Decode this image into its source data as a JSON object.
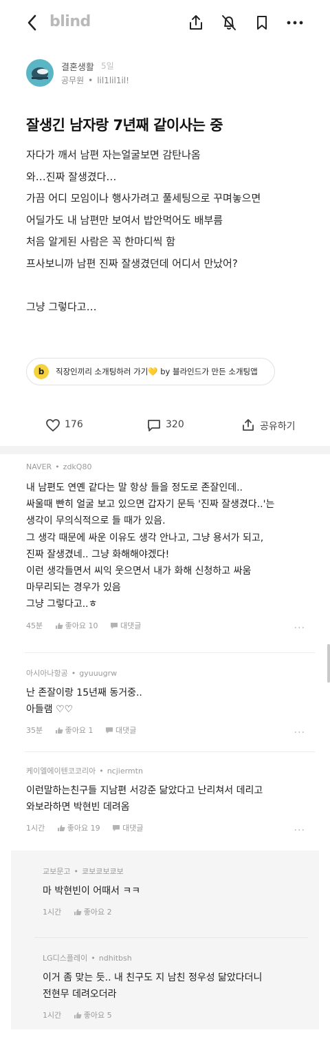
{
  "app": {
    "brand": "blind"
  },
  "toolbar": {
    "back_icon": "chevron-left-icon",
    "share_icon": "share-upload-icon",
    "notify_icon": "bell-off-icon",
    "bookmark_icon": "bookmark-icon",
    "more_icon": "more-dots-icon"
  },
  "post": {
    "board": "결혼생활",
    "time": "5일",
    "company": "공무원",
    "nickname": "lil1lil1il!",
    "title": "잘생긴 남자랑 7년째 같이사는 중",
    "body_lines": [
      "자다가 깨서 남편 자는얼굴보면 감탄나옴",
      "와…진짜 잘생겼다…",
      "가끔 어디 모임이나 행사가려고 풀세팅으로 꾸며놓으면",
      "어딜가도 내 남편만 보여서 밥안먹어도 배부름",
      "처음 알게된 사람은 꼭 한마디씩 함",
      "프사보니까 남편 진짜 잘생겼던데 어디서 만났어?",
      "",
      "그냥 그렇다고…"
    ]
  },
  "promo": {
    "badge": "b",
    "text": "직장인끼리 소개팅하러 가기💛 by 블라인드가 만든 소개팅앱"
  },
  "stats": {
    "likes": "176",
    "comments": "320",
    "share_label": "공유하기"
  },
  "comments": [
    {
      "company": "NAVER",
      "nickname": "zdkQ80",
      "lines": [
        "내 남편도 연옌 같다는 말 항상 들을 정도로 존잘인데..",
        "싸울때 빤히 얼굴 보고 있으면 갑자기 문득 '진짜 잘생겼다..'는",
        "생각이 무의식적으로 들 때가 있음.",
        "그 생각 때문에 싸운 이유도 생각 안나고, 그냥 용서가 되고,",
        "진짜 잘생겼네.. 그냥 화해해야겠다!",
        "이런 생각들면서 씨익 웃으면서 내가 화해 신청하고 싸움",
        "마무리되는 경우가 있음",
        "그냥 그렇다고..ㅎ"
      ],
      "time": "45분",
      "like_label": "좋아요 10",
      "reply_label": "대댓글",
      "more": "..."
    },
    {
      "company": "아시아나항공",
      "nickname": "gyuuugrw",
      "lines": [
        "난 존잘이랑 15년째 동거중..",
        "아들램 ♡♡"
      ],
      "time": "35분",
      "like_label": "좋아요 1",
      "reply_label": "대댓글",
      "more": "..."
    },
    {
      "company": "케이엘에이텐코코리아",
      "nickname": "ncjiermtn",
      "lines": [
        "이런말하는친구들 지남편 서강준 닮았다고 난리쳐서 데리고",
        "와보라하면 박현빈 데려옴"
      ],
      "time": "1시간",
      "like_label": "좋아요 19",
      "reply_label": "대댓글",
      "more": "..."
    }
  ],
  "replies": [
    {
      "company": "교보문고",
      "nickname": "쿄보쿄보쿄보",
      "lines": [
        "마 박현빈이 어때서 ㅋㅋ"
      ],
      "time": "1시간",
      "like_label": "좋아요 2"
    },
    {
      "company": "LG디스플레이",
      "nickname": "ndhitbsh",
      "lines": [
        "이거 좀 맞는 듯.. 내 친구도 지 남친 정우성 닮았다더니",
        "전현무 데려오더라"
      ],
      "time": "1시간",
      "like_label": "좋아요 5"
    }
  ]
}
